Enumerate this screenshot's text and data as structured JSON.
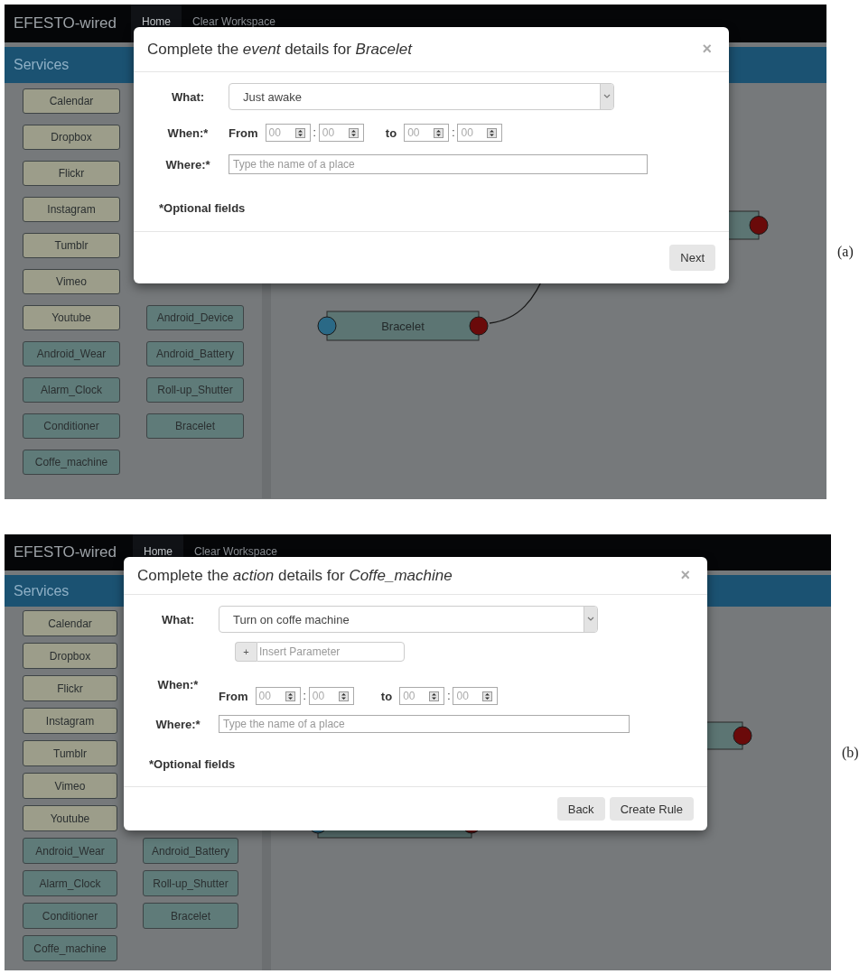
{
  "panels": [
    {
      "caption": "(a)",
      "navbar": {
        "brand": "EFESTO-wired",
        "links": [
          {
            "label": "Home",
            "selected": true
          },
          {
            "label": "Clear Workspace",
            "selected": false
          }
        ]
      },
      "sidebar": {
        "title": "Services",
        "column_1": [
          {
            "label": "Calendar",
            "kind": "web"
          },
          {
            "label": "Dropbox",
            "kind": "web"
          },
          {
            "label": "Flickr",
            "kind": "web"
          },
          {
            "label": "Instagram",
            "kind": "web"
          },
          {
            "label": "Tumblr",
            "kind": "web"
          },
          {
            "label": "Vimeo",
            "kind": "web"
          },
          {
            "label": "Youtube",
            "kind": "web"
          },
          {
            "label": "Android_Wear",
            "kind": "device"
          },
          {
            "label": "Alarm_Clock",
            "kind": "device"
          },
          {
            "label": "Conditioner",
            "kind": "device"
          },
          {
            "label": "Coffe_machine",
            "kind": "device"
          }
        ],
        "column_2": [
          {
            "label": "Android_Device",
            "kind": "device"
          },
          {
            "label": "Android_Battery",
            "kind": "device"
          },
          {
            "label": "Roll-up_Shutter",
            "kind": "device"
          },
          {
            "label": "Bracelet",
            "kind": "device"
          }
        ]
      },
      "workspace": {
        "nodes": [
          {
            "kind": "service",
            "label": "Bracelet"
          },
          {
            "kind": "service"
          }
        ]
      },
      "modal": {
        "title": "Complete the *event* details for *Bracelet*",
        "close": "×",
        "what": {
          "label": "What:",
          "value": "Just awake"
        },
        "when": {
          "label": "When:*",
          "from": "From",
          "to": "to",
          "separators": [
            ":",
            ":"
          ],
          "times": [
            "00",
            "00",
            "00",
            "00"
          ]
        },
        "where": {
          "label": "Where:*",
          "placeholder": "Type the name of a place"
        },
        "note": "*Optional fields",
        "buttons": [
          "Next"
        ]
      }
    },
    {
      "caption": "(b)",
      "navbar": {
        "brand": "EFESTO-wired",
        "links": [
          {
            "label": "Home",
            "selected": true
          },
          {
            "label": "Clear Workspace",
            "selected": false
          }
        ]
      },
      "sidebar": {
        "title": "Services",
        "column_1": [
          {
            "label": "Calendar",
            "kind": "web"
          },
          {
            "label": "Dropbox",
            "kind": "web"
          },
          {
            "label": "Flickr",
            "kind": "web"
          },
          {
            "label": "Instagram",
            "kind": "web"
          },
          {
            "label": "Tumblr",
            "kind": "web"
          },
          {
            "label": "Vimeo",
            "kind": "web"
          },
          {
            "label": "Youtube",
            "kind": "web"
          },
          {
            "label": "Android_Wear",
            "kind": "device"
          },
          {
            "label": "Alarm_Clock",
            "kind": "device"
          },
          {
            "label": "Conditioner",
            "kind": "device"
          },
          {
            "label": "Coffe_machine",
            "kind": "device"
          }
        ],
        "column_2": [
          {
            "label": "Android_Battery",
            "kind": "device"
          },
          {
            "label": "Roll-up_Shutter",
            "kind": "device"
          },
          {
            "label": "Bracelet",
            "kind": "device"
          }
        ]
      },
      "workspace": {
        "nodes": [
          {
            "kind": "service"
          },
          {
            "kind": "service"
          }
        ]
      },
      "modal": {
        "title": "Complete the *action* details for *Coffe_machine*",
        "close": "×",
        "what": {
          "label": "What:",
          "value": "Turn on coffe machine"
        },
        "parameter": {
          "icon": "+",
          "placeholder": "Insert Parameter"
        },
        "when": {
          "label": "When:*",
          "from": "From",
          "to": "to",
          "separators": [
            ":",
            ":"
          ],
          "times": [
            "00",
            "00",
            "00",
            "00"
          ]
        },
        "where": {
          "label": "Where:*",
          "placeholder": "Type the name of a place"
        },
        "note": "*Optional fields",
        "buttons": [
          "Back",
          "Create Rule"
        ]
      }
    }
  ]
}
